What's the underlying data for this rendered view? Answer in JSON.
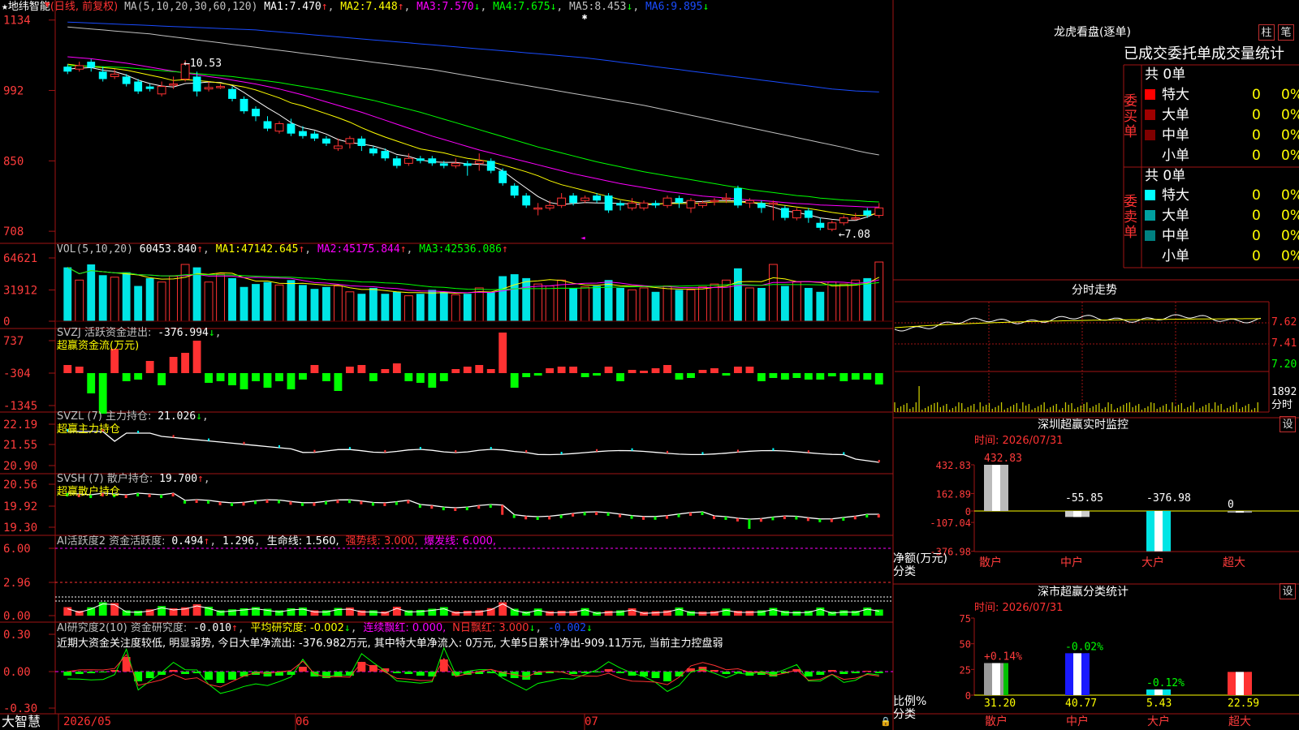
{
  "colors": {
    "up": "#ff3232",
    "down": "#00ffff",
    "volDown": "#00e5e5",
    "ma1": "#ffffff",
    "ma2": "#ffff00",
    "ma3": "#ff00ff",
    "ma4": "#00ff00",
    "ma5": "#c0c0c0",
    "ma6": "#1a4cff",
    "grid": "#a01414",
    "axisText": "#ff3c3c",
    "bg": "#000000"
  },
  "header": {
    "star": "★",
    "name": "地纬智能",
    "mode": "(日线, 前复权)",
    "ma_param": "MA(5,10,20,30,60,120)",
    "ma": [
      {
        "label": "MA1:",
        "value": "7.470",
        "arrow": "↑"
      },
      {
        "label": "MA2:",
        "value": "7.448",
        "arrow": "↑"
      },
      {
        "label": "MA3:",
        "value": "7.570",
        "arrow": "↓"
      },
      {
        "label": "MA4:",
        "value": "7.675",
        "arrow": "↓"
      },
      {
        "label": "MA5:",
        "value": "8.453",
        "arrow": "↓"
      },
      {
        "label": "MA6:",
        "value": "9.895",
        "arrow": "↓"
      }
    ],
    "top_icon": "▼"
  },
  "price_axis": [
    "1134",
    "992",
    "850",
    "708"
  ],
  "annotations": {
    "high": "10.53",
    "low": "7.08"
  },
  "vol": {
    "title": "VOL(5,10,20)",
    "value": "60453.840",
    "arrow": "↑",
    "ma": [
      {
        "label": "MA1:",
        "value": "47142.645",
        "arrow": "↑"
      },
      {
        "label": "MA2:",
        "value": "45175.844",
        "arrow": "↑"
      },
      {
        "label": "MA3:",
        "value": "42536.086",
        "arrow": "↑"
      }
    ],
    "axis": [
      "64621",
      "31912",
      "0"
    ]
  },
  "svzj": {
    "title": "SVZJ  活跃资金进出:",
    "value": "-376.994",
    "arrow": "↓",
    "sub": "超赢资金流(万元)",
    "axis": [
      "737",
      "-304",
      "-1345"
    ]
  },
  "svzl": {
    "title": "SVZL (7) 主力持仓:",
    "value": "21.026",
    "arrow": "↓",
    "sub": "超赢主力持仓",
    "axis": [
      "22.19",
      "21.55",
      "20.90"
    ]
  },
  "svsh": {
    "title": "SVSH (7) 散户持仓:",
    "value": "19.700",
    "arrow": "↑",
    "sub": "超赢散户持仓",
    "axis": [
      "20.56",
      "19.92",
      "19.30"
    ]
  },
  "ai1": {
    "title": "AI活跃度2 资金活跃度:",
    "v1": "0.494",
    "v2": "1.296",
    "life": "生命线: 1.560,",
    "strong": "强势线: 3.000,",
    "burst": "爆发线: 6.000,",
    "axis": [
      "6.00",
      "2.96",
      "0.00"
    ]
  },
  "ai2": {
    "title": "AI研究度2(10) 资金研究度:",
    "v1": "-0.010",
    "avg": "平均研究度: -0.002",
    "red": "连续飘红: 0.000,",
    "nred": "N日飘红: 3.000",
    "last": "-0.002",
    "note": "近期大资金关注度较低, 明显弱势, 今日大单净流出: -376.982万元, 其中特大单净流入: 0万元, 大单5日累计净出-909.11万元, 当前主力控盘弱",
    "axis": [
      "0.30",
      "0.00",
      "-0.30"
    ]
  },
  "date_axis": [
    "2026/05",
    "06",
    "07"
  ],
  "footer": {
    "brand": "大智慧"
  },
  "lhb": {
    "title": "龙虎看盘(逐单)",
    "btn1": "柱",
    "btn2": "笔",
    "subtitle": "已成交委托单成交量统计",
    "buy_label": "委买单",
    "sell_label": "委卖单",
    "total": "共 0单",
    "buy": [
      {
        "name": "特大",
        "count": "0",
        "pct": "0%",
        "color": "#ff0000"
      },
      {
        "name": "大单",
        "count": "0",
        "pct": "0%",
        "color": "#a00000"
      },
      {
        "name": "中单",
        "count": "0",
        "pct": "0%",
        "color": "#800000"
      },
      {
        "name": "小单",
        "count": "0",
        "pct": "0%",
        "color": ""
      }
    ],
    "sell": [
      {
        "name": "特大",
        "count": "0",
        "pct": "0%",
        "color": "#00ffff"
      },
      {
        "name": "大单",
        "count": "0",
        "pct": "0%",
        "color": "#00a0a0"
      },
      {
        "name": "中单",
        "count": "0",
        "pct": "0%",
        "color": "#008080"
      },
      {
        "name": "小单",
        "count": "0",
        "pct": "0%",
        "color": ""
      }
    ]
  },
  "intraday": {
    "title": "分时走势",
    "axis": [
      "7.62",
      "7.41",
      "7.20"
    ],
    "vol_label": "1892",
    "vol_sub": "分时"
  },
  "sz_monitor": {
    "title": "深圳超赢实时监控",
    "btn": "设",
    "time": "时间: 2026/07/31",
    "axis": [
      "432.83",
      "162.89",
      "0",
      "-107.04",
      "-376.98"
    ],
    "bars": [
      {
        "cat": "散户",
        "value": 432.83,
        "label": "432.83"
      },
      {
        "cat": "中户",
        "value": -55.85,
        "label": "-55.85"
      },
      {
        "cat": "大户",
        "value": -376.98,
        "label": "-376.98"
      },
      {
        "cat": "超大",
        "value": 0,
        "label": "0"
      }
    ],
    "ylabel1": "净额(万元)",
    "ylabel2": "分类"
  },
  "sz_class": {
    "title": "深市超赢分类统计",
    "btn": "设",
    "time": "时间: 2026/07/31",
    "axis": [
      "75",
      "50",
      "25",
      "0"
    ],
    "bars": [
      {
        "cat": "散户",
        "value": 31.2,
        "label": "31.20",
        "delta": "+0.14%"
      },
      {
        "cat": "中户",
        "value": 40.77,
        "label": "40.77",
        "delta": "-0.02%"
      },
      {
        "cat": "大户",
        "value": 5.43,
        "label": "5.43",
        "delta": "-0.12%"
      },
      {
        "cat": "超大",
        "value": 22.59,
        "label": "22.59",
        "delta": ""
      }
    ],
    "ylabel1": "比例%",
    "ylabel2": "分类"
  },
  "chart_data": {
    "type": "candlestick",
    "candles": [
      [
        10.4,
        10.3,
        10.45,
        10.25
      ],
      [
        10.35,
        10.42,
        10.5,
        10.3
      ],
      [
        10.5,
        10.38,
        10.55,
        10.3
      ],
      [
        10.3,
        10.15,
        10.4,
        10.1
      ],
      [
        10.2,
        10.25,
        10.35,
        10.15
      ],
      [
        10.2,
        10.05,
        10.25,
        10.0
      ],
      [
        10.1,
        9.9,
        10.15,
        9.85
      ],
      [
        10.0,
        9.95,
        10.05,
        9.9
      ],
      [
        9.85,
        10.0,
        10.1,
        9.8
      ],
      [
        10.05,
        10.05,
        10.2,
        9.95
      ],
      [
        10.15,
        10.45,
        10.53,
        10.1
      ],
      [
        10.2,
        9.9,
        10.3,
        9.8
      ],
      [
        9.95,
        9.98,
        10.1,
        9.9
      ],
      [
        10.0,
        10.0,
        10.05,
        9.95
      ],
      [
        9.95,
        9.75,
        10.0,
        9.7
      ],
      [
        9.75,
        9.5,
        9.8,
        9.45
      ],
      [
        9.55,
        9.4,
        9.6,
        9.3
      ],
      [
        9.3,
        9.15,
        9.4,
        9.1
      ],
      [
        9.1,
        9.25,
        9.3,
        9.05
      ],
      [
        9.25,
        9.05,
        9.35,
        9.0
      ],
      [
        9.1,
        9.0,
        9.2,
        8.95
      ],
      [
        9.05,
        8.95,
        9.1,
        8.9
      ],
      [
        8.95,
        8.85,
        9.0,
        8.8
      ],
      [
        8.75,
        8.8,
        8.95,
        8.7
      ],
      [
        8.85,
        8.95,
        9.0,
        8.75
      ],
      [
        8.95,
        8.8,
        9.0,
        8.7
      ],
      [
        8.75,
        8.65,
        8.8,
        8.6
      ],
      [
        8.7,
        8.55,
        8.75,
        8.5
      ],
      [
        8.55,
        8.4,
        8.6,
        8.35
      ],
      [
        8.45,
        8.55,
        8.65,
        8.4
      ],
      [
        8.55,
        8.5,
        8.6,
        8.45
      ],
      [
        8.55,
        8.45,
        8.6,
        8.4
      ],
      [
        8.45,
        8.4,
        8.5,
        8.35
      ],
      [
        8.4,
        8.45,
        8.55,
        8.35
      ],
      [
        8.45,
        8.4,
        8.5,
        8.2
      ],
      [
        8.45,
        8.5,
        8.65,
        8.3
      ],
      [
        8.5,
        8.3,
        8.55,
        8.25
      ],
      [
        8.3,
        8.05,
        8.35,
        8.0
      ],
      [
        8.0,
        7.8,
        8.05,
        7.75
      ],
      [
        7.8,
        7.6,
        7.85,
        7.55
      ],
      [
        7.55,
        7.55,
        7.65,
        7.4
      ],
      [
        7.55,
        7.6,
        7.7,
        7.5
      ],
      [
        7.6,
        7.75,
        7.85,
        7.55
      ],
      [
        7.8,
        7.65,
        7.85,
        7.6
      ],
      [
        7.7,
        7.75,
        7.8,
        7.65
      ],
      [
        7.8,
        7.7,
        7.85,
        7.65
      ],
      [
        7.8,
        7.5,
        7.85,
        7.45
      ],
      [
        7.65,
        7.6,
        7.7,
        7.5
      ],
      [
        7.55,
        7.65,
        7.75,
        7.5
      ],
      [
        7.55,
        7.65,
        7.7,
        7.5
      ],
      [
        7.65,
        7.6,
        7.7,
        7.55
      ],
      [
        7.6,
        7.75,
        7.8,
        7.55
      ],
      [
        7.75,
        7.65,
        7.8,
        7.55
      ],
      [
        7.55,
        7.7,
        7.75,
        7.45
      ],
      [
        7.6,
        7.65,
        7.7,
        7.55
      ],
      [
        7.7,
        7.7,
        7.75,
        7.6
      ],
      [
        7.75,
        7.75,
        7.85,
        7.65
      ],
      [
        7.95,
        7.6,
        8.0,
        7.55
      ],
      [
        7.65,
        7.7,
        7.75,
        7.55
      ],
      [
        7.65,
        7.55,
        7.7,
        7.45
      ],
      [
        7.65,
        7.65,
        7.7,
        7.3
      ],
      [
        7.55,
        7.35,
        7.6,
        7.3
      ],
      [
        7.35,
        7.5,
        7.55,
        7.3
      ],
      [
        7.5,
        7.35,
        7.55,
        7.25
      ],
      [
        7.25,
        7.15,
        7.35,
        7.1
      ],
      [
        7.12,
        7.25,
        7.3,
        7.08
      ],
      [
        7.25,
        7.35,
        7.4,
        7.2
      ],
      [
        7.35,
        7.35,
        7.45,
        7.3
      ],
      [
        7.5,
        7.4,
        7.55,
        7.35
      ],
      [
        7.4,
        7.55,
        7.65,
        7.35
      ]
    ],
    "ma_lines": {
      "ma1": [
        10.35,
        10.37,
        10.38,
        10.33,
        10.3,
        10.23,
        10.13,
        10.06,
        10.01,
        9.99,
        10.06,
        10.07,
        10.09,
        10.08,
        10.02,
        9.88,
        9.72,
        9.57,
        9.43,
        9.27,
        9.17,
        9.12,
        9.04,
        8.93,
        8.87,
        8.84,
        8.8,
        8.73,
        8.63,
        8.59,
        8.52,
        8.48,
        8.47,
        8.47,
        8.44,
        8.43,
        8.41,
        8.3,
        8.12,
        7.95,
        7.78,
        7.66,
        7.62,
        7.64,
        7.66,
        7.65,
        7.65,
        7.64,
        7.63,
        7.62,
        7.62,
        7.65,
        7.66,
        7.67,
        7.68,
        7.7,
        7.7,
        7.69,
        7.67,
        7.62,
        7.57,
        7.49,
        7.46,
        7.41,
        7.35,
        7.32,
        7.3,
        7.3,
        7.37,
        7.47
      ],
      "ma2": [
        10.45,
        10.42,
        10.4,
        10.38,
        10.36,
        10.33,
        10.28,
        10.23,
        10.18,
        10.12,
        10.14,
        10.12,
        10.1,
        10.07,
        10.03,
        9.99,
        9.93,
        9.85,
        9.77,
        9.67,
        9.61,
        9.53,
        9.45,
        9.37,
        9.28,
        9.17,
        9.07,
        8.98,
        8.9,
        8.82,
        8.74,
        8.7,
        8.66,
        8.6,
        8.55,
        8.52,
        8.48,
        8.42,
        8.35,
        8.28,
        8.2,
        8.1,
        8.02,
        7.96,
        7.9,
        7.84,
        7.78,
        7.72,
        7.68,
        7.64,
        7.63,
        7.64,
        7.64,
        7.64,
        7.65,
        7.67,
        7.67,
        7.67,
        7.66,
        7.65,
        7.63,
        7.6,
        7.57,
        7.54,
        7.5,
        7.46,
        7.43,
        7.4,
        7.4,
        7.45
      ],
      "ma3": [
        10.6,
        10.58,
        10.56,
        10.53,
        10.5,
        10.47,
        10.43,
        10.39,
        10.35,
        10.31,
        10.27,
        10.24,
        10.2,
        10.17,
        10.13,
        10.09,
        10.05,
        10.0,
        9.95,
        9.89,
        9.83,
        9.76,
        9.69,
        9.62,
        9.55,
        9.48,
        9.4,
        9.32,
        9.24,
        9.16,
        9.08,
        9.0,
        8.93,
        8.86,
        8.79,
        8.72,
        8.66,
        8.6,
        8.54,
        8.48,
        8.42,
        8.36,
        8.3,
        8.24,
        8.19,
        8.14,
        8.09,
        8.04,
        8.0,
        7.96,
        7.92,
        7.88,
        7.85,
        7.82,
        7.79,
        7.77,
        7.75,
        7.73,
        7.71,
        7.7,
        7.68,
        7.66,
        7.64,
        7.63,
        7.61,
        7.6,
        7.59,
        7.58,
        7.57,
        7.57
      ],
      "ma4": [
        10.42,
        10.42,
        10.41,
        10.4,
        10.39,
        10.38,
        10.36,
        10.34,
        10.32,
        10.3,
        10.28,
        10.26,
        10.24,
        10.22,
        10.2,
        10.17,
        10.14,
        10.11,
        10.08,
        10.04,
        10.0,
        9.96,
        9.92,
        9.87,
        9.82,
        9.77,
        9.72,
        9.66,
        9.6,
        9.54,
        9.48,
        9.41,
        9.34,
        9.27,
        9.2,
        9.13,
        9.06,
        8.99,
        8.92,
        8.85,
        8.78,
        8.72,
        8.66,
        8.6,
        8.54,
        8.48,
        8.43,
        8.38,
        8.33,
        8.28,
        8.24,
        8.2,
        8.16,
        8.12,
        8.08,
        8.04,
        8.0,
        7.96,
        7.92,
        7.89,
        7.86,
        7.83,
        7.8,
        7.78,
        7.75,
        7.73,
        7.71,
        7.7,
        7.68,
        7.67
      ],
      "ma5": [
        11.2,
        11.18,
        11.16,
        11.14,
        11.12,
        11.1,
        11.08,
        11.06,
        11.03,
        11.0,
        10.97,
        10.94,
        10.91,
        10.88,
        10.85,
        10.82,
        10.79,
        10.76,
        10.73,
        10.7,
        10.67,
        10.64,
        10.61,
        10.58,
        10.55,
        10.52,
        10.49,
        10.46,
        10.43,
        10.4,
        10.37,
        10.34,
        10.3,
        10.26,
        10.22,
        10.18,
        10.14,
        10.1,
        10.06,
        10.02,
        9.98,
        9.94,
        9.9,
        9.86,
        9.82,
        9.78,
        9.74,
        9.7,
        9.66,
        9.62,
        9.57,
        9.52,
        9.47,
        9.42,
        9.37,
        9.32,
        9.27,
        9.22,
        9.17,
        9.12,
        9.07,
        9.02,
        8.97,
        8.92,
        8.87,
        8.82,
        8.77,
        8.71,
        8.66,
        8.62
      ],
      "ma6": [
        11.3,
        11.29,
        11.28,
        11.27,
        11.26,
        11.25,
        11.24,
        11.23,
        11.22,
        11.21,
        11.2,
        11.19,
        11.18,
        11.17,
        11.16,
        11.15,
        11.14,
        11.12,
        11.1,
        11.08,
        11.06,
        11.04,
        11.02,
        11.0,
        10.98,
        10.96,
        10.94,
        10.92,
        10.9,
        10.88,
        10.86,
        10.84,
        10.82,
        10.8,
        10.78,
        10.76,
        10.74,
        10.72,
        10.7,
        10.68,
        10.66,
        10.64,
        10.62,
        10.6,
        10.58,
        10.55,
        10.52,
        10.49,
        10.46,
        10.43,
        10.4,
        10.37,
        10.34,
        10.31,
        10.28,
        10.25,
        10.22,
        10.19,
        10.16,
        10.13,
        10.1,
        10.07,
        10.04,
        10.01,
        9.98,
        9.95,
        9.93,
        9.91,
        9.9,
        9.89
      ]
    },
    "volumes": [
      55000,
      42000,
      58000,
      47000,
      45000,
      50000,
      36000,
      44000,
      40000,
      46000,
      58000,
      55000,
      40000,
      48000,
      44000,
      35000,
      38000,
      40000,
      37000,
      42000,
      37000,
      33000,
      35000,
      36000,
      30000,
      28000,
      34000,
      28000,
      30000,
      26000,
      28000,
      32000,
      30000,
      27000,
      28000,
      34000,
      30000,
      46000,
      48000,
      44000,
      38000,
      36000,
      42000,
      34000,
      35000,
      36000,
      42000,
      34000,
      32000,
      34000,
      30000,
      36000,
      32000,
      32000,
      35000,
      38000,
      42000,
      54000,
      34000,
      34000,
      58000,
      36000,
      40000,
      34000,
      30000,
      40000,
      38000,
      42000,
      44000,
      60453
    ]
  }
}
